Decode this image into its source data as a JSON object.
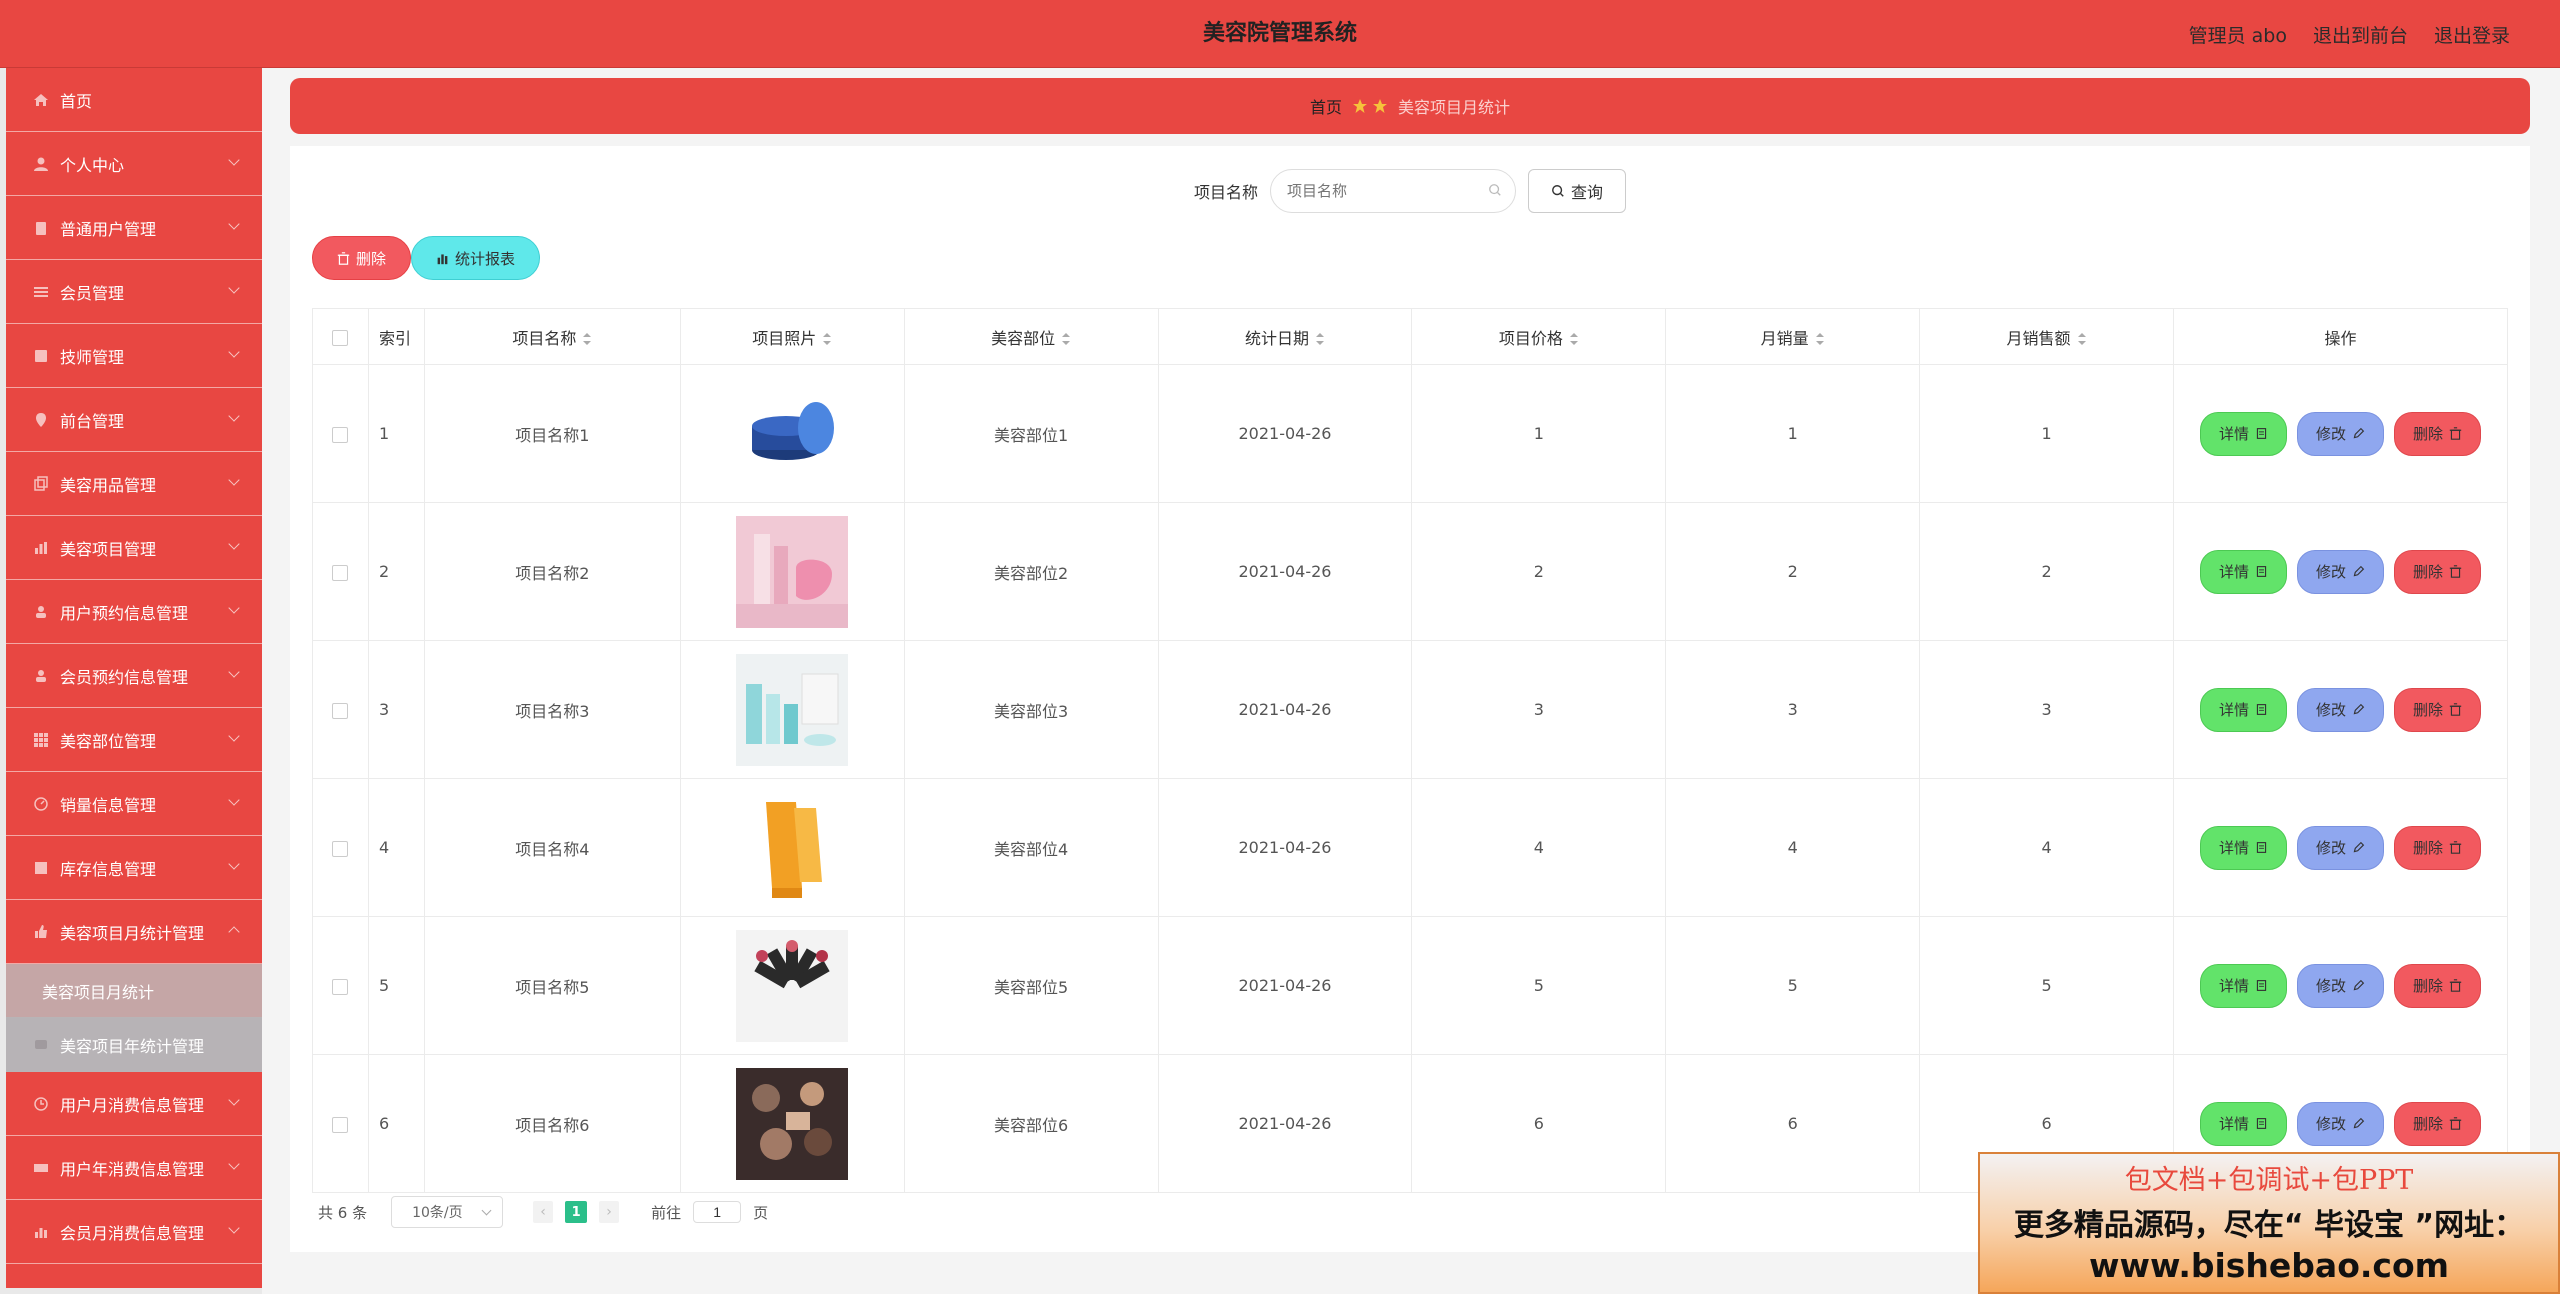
{
  "header": {
    "title": "美容院管理系统",
    "user_label": "管理员 abo",
    "to_front": "退出到前台",
    "logout": "退出登录"
  },
  "sidebar": {
    "items": [
      {
        "label": "首页",
        "icon": "home-icon"
      },
      {
        "label": "个人中心",
        "icon": "user-icon"
      },
      {
        "label": "普通用户管理",
        "icon": "clipboard-icon"
      },
      {
        "label": "会员管理",
        "icon": "list-icon"
      },
      {
        "label": "技师管理",
        "icon": "book-icon"
      },
      {
        "label": "前台管理",
        "icon": "location-icon"
      },
      {
        "label": "美容用品管理",
        "icon": "copy-icon"
      },
      {
        "label": "美容项目管理",
        "icon": "chart-icon"
      },
      {
        "label": "用户预约信息管理",
        "icon": "person-icon"
      },
      {
        "label": "会员预约信息管理",
        "icon": "person-icon"
      },
      {
        "label": "美容部位管理",
        "icon": "grid-icon"
      },
      {
        "label": "销量信息管理",
        "icon": "dashboard-icon"
      },
      {
        "label": "库存信息管理",
        "icon": "document-icon"
      },
      {
        "label": "美容项目月统计管理",
        "icon": "thumb-icon"
      }
    ],
    "sub_active": "美容项目月统计",
    "sub_next": "美容项目年统计管理",
    "items_after": [
      {
        "label": "用户月消费信息管理",
        "icon": "clock-icon"
      },
      {
        "label": "用户年消费信息管理",
        "icon": "ticket-icon"
      },
      {
        "label": "会员月消费信息管理",
        "icon": "bar-chart-icon"
      }
    ]
  },
  "breadcrumb": {
    "home": "首页",
    "current": "美容项目月统计"
  },
  "search": {
    "label": "项目名称",
    "placeholder": "项目名称",
    "button": "查询"
  },
  "actions": {
    "delete": "删除",
    "report": "统计报表"
  },
  "table": {
    "headers": [
      "索引",
      "项目名称",
      "项目照片",
      "美容部位",
      "统计日期",
      "项目价格",
      "月销量",
      "月销售额",
      "操作"
    ],
    "rows": [
      {
        "index": "1",
        "name": "项目名称1",
        "part": "美容部位1",
        "date": "2021-04-26",
        "price": "1",
        "sales": "1",
        "revenue": "1"
      },
      {
        "index": "2",
        "name": "项目名称2",
        "part": "美容部位2",
        "date": "2021-04-26",
        "price": "2",
        "sales": "2",
        "revenue": "2"
      },
      {
        "index": "3",
        "name": "项目名称3",
        "part": "美容部位3",
        "date": "2021-04-26",
        "price": "3",
        "sales": "3",
        "revenue": "3"
      },
      {
        "index": "4",
        "name": "项目名称4",
        "part": "美容部位4",
        "date": "2021-04-26",
        "price": "4",
        "sales": "4",
        "revenue": "4"
      },
      {
        "index": "5",
        "name": "项目名称5",
        "part": "美容部位5",
        "date": "2021-04-26",
        "price": "5",
        "sales": "5",
        "revenue": "5"
      },
      {
        "index": "6",
        "name": "项目名称6",
        "part": "美容部位6",
        "date": "2021-04-26",
        "price": "6",
        "sales": "6",
        "revenue": "6"
      }
    ],
    "op_detail": "详情",
    "op_edit": "修改",
    "op_delete": "删除"
  },
  "pager": {
    "total": "共 6 条",
    "page_size": "10条/页",
    "current_page": "1",
    "goto_label": "前往",
    "goto_value": "1",
    "page_unit": "页"
  },
  "ad": {
    "line1": "包文档+包调试+包PPT",
    "line2": "更多精品源码，尽在“ 毕设宝 ”网址：",
    "line3": "www.bishebao.com"
  },
  "colors": {
    "primary": "#e84742",
    "detail": "#62e36a",
    "edit": "#8fa7ef",
    "danger": "#f2595f",
    "report": "#5fe8ea",
    "pager_active": "#2bbf8a"
  }
}
